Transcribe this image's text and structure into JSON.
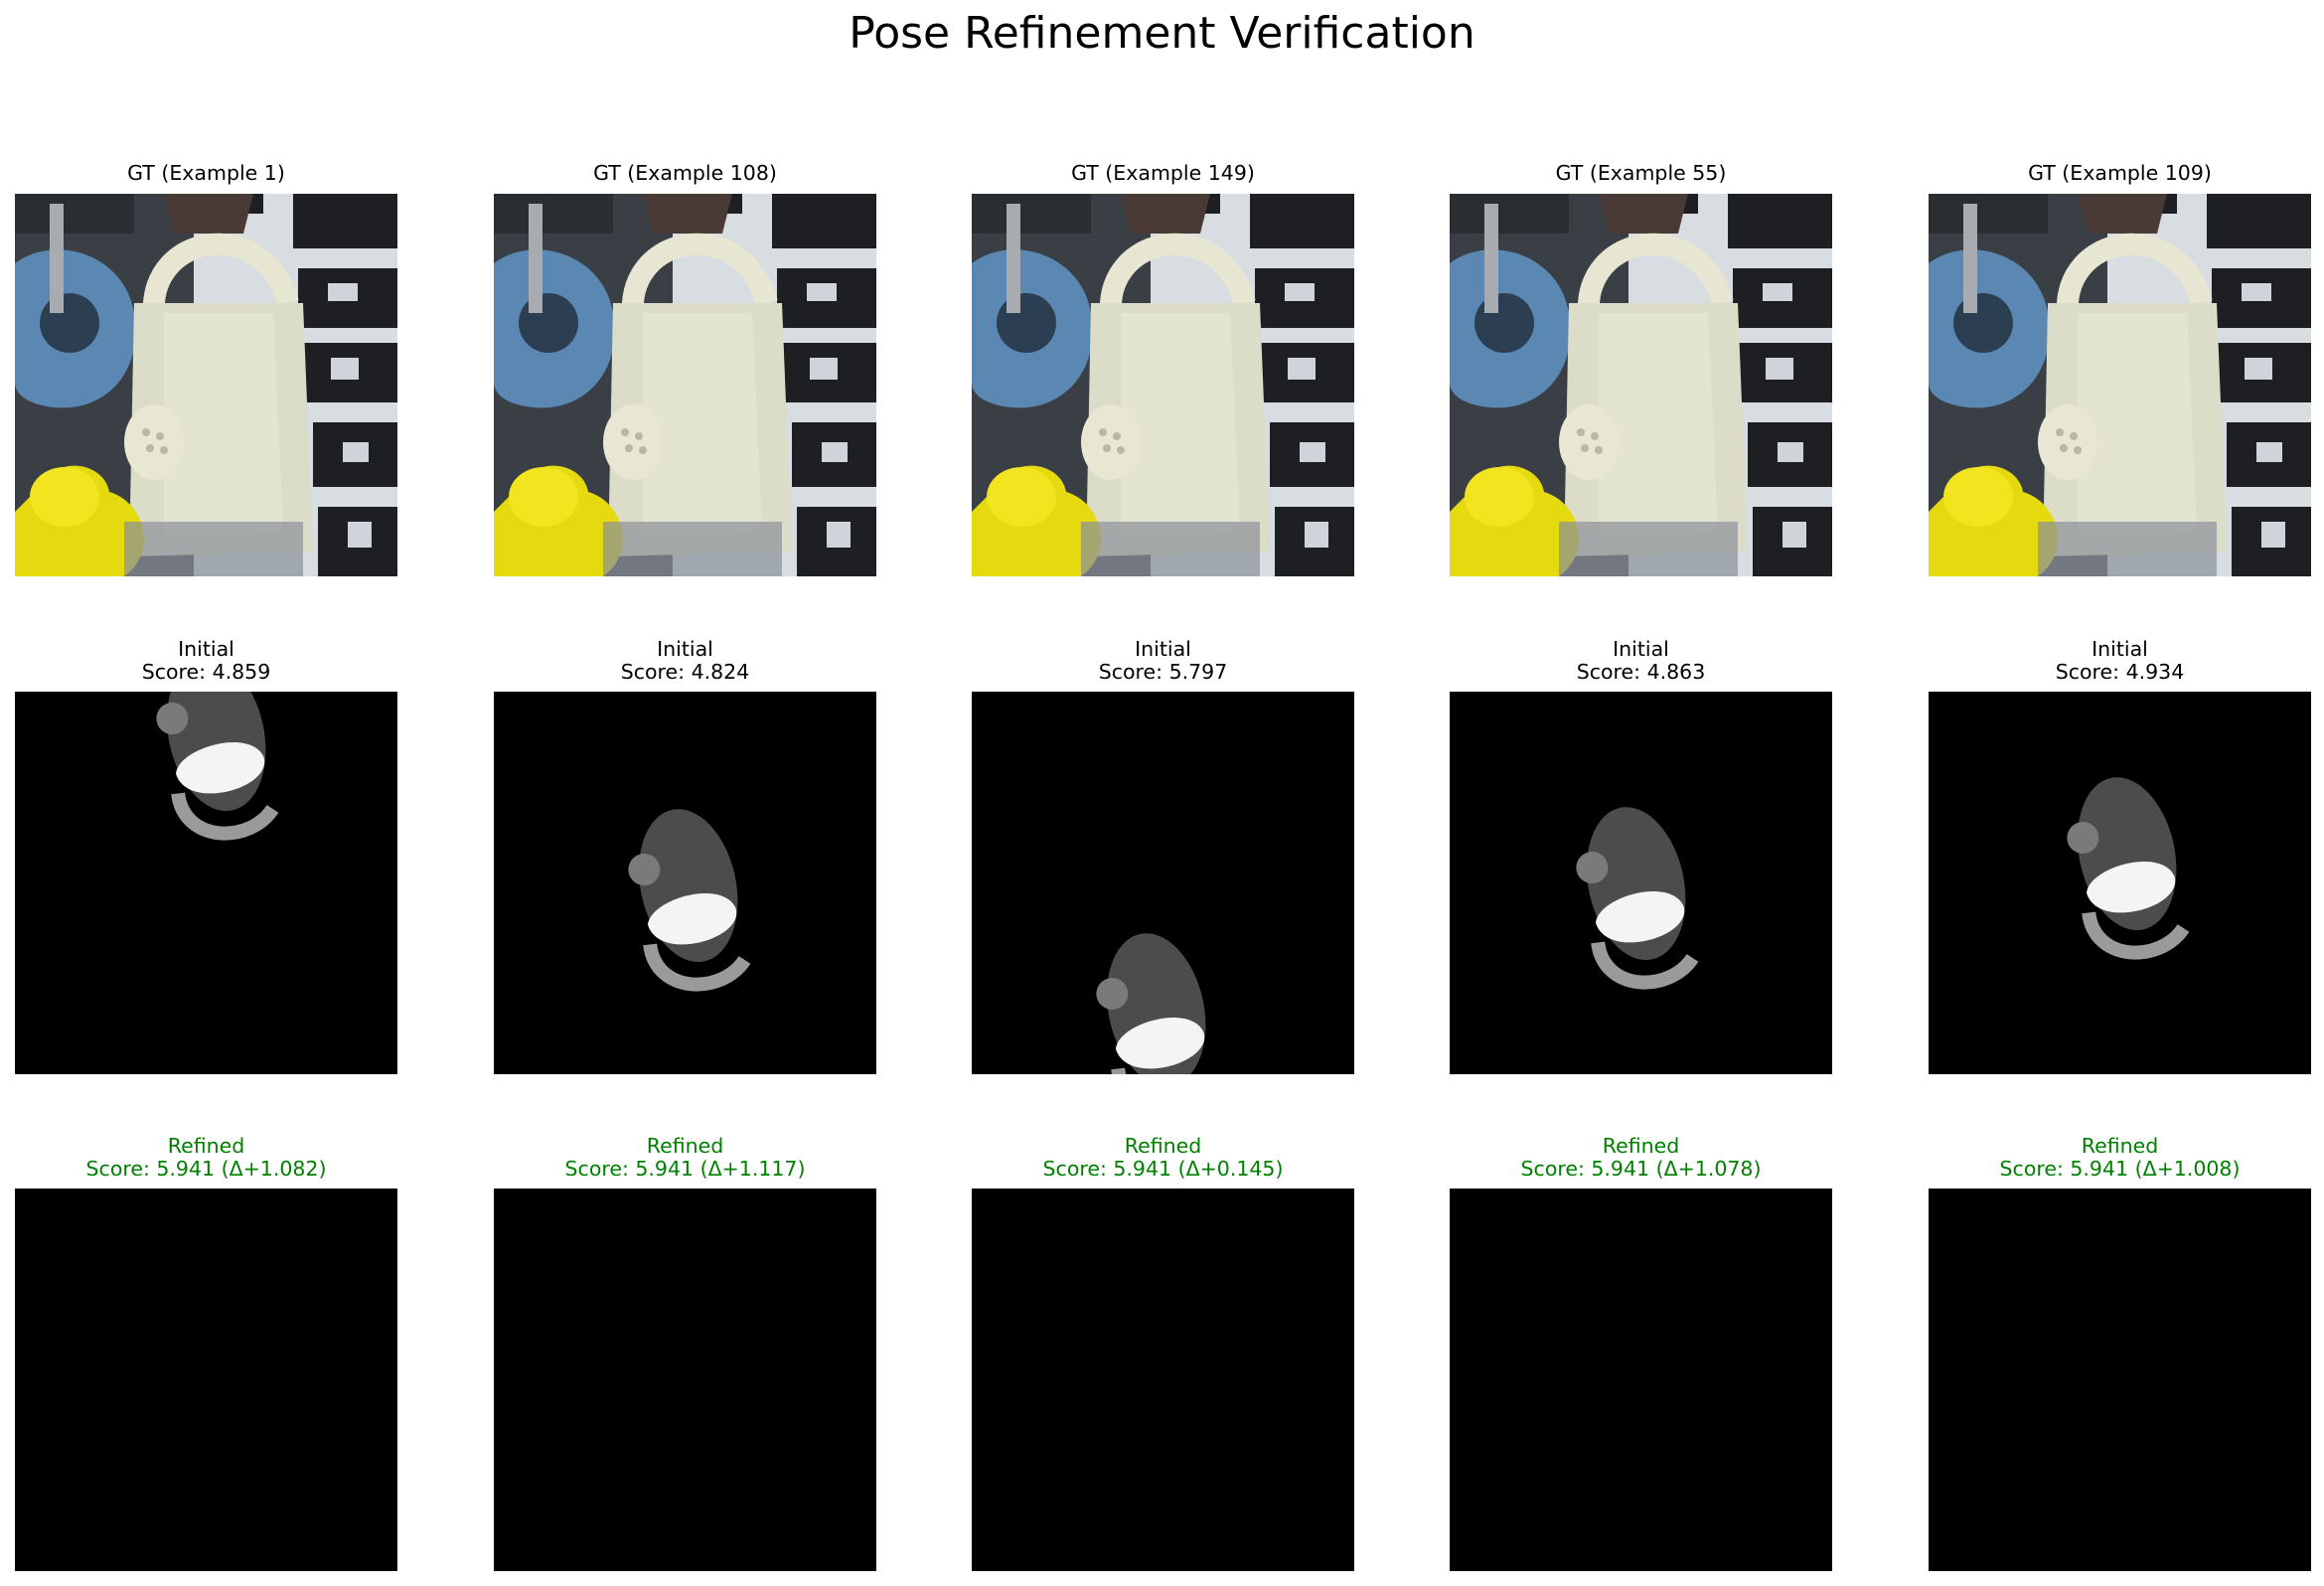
{
  "title": "Pose Refinement Verification",
  "columns": [
    {
      "gt_label": "GT (Example 1)",
      "initial_line1": "Initial",
      "initial_line2": "Score: 4.859",
      "refined_line1": "Refined",
      "refined_line2": "Score: 5.941 (Δ+1.082)"
    },
    {
      "gt_label": "GT (Example 108)",
      "initial_line1": "Initial",
      "initial_line2": "Score: 4.824",
      "refined_line1": "Refined",
      "refined_line2": "Score: 5.941 (Δ+1.117)"
    },
    {
      "gt_label": "GT (Example 149)",
      "initial_line1": "Initial",
      "initial_line2": "Score: 5.797",
      "refined_line1": "Refined",
      "refined_line2": "Score: 5.941 (Δ+0.145)"
    },
    {
      "gt_label": "GT (Example 55)",
      "initial_line1": "Initial",
      "initial_line2": "Score: 4.863",
      "refined_line1": "Refined",
      "refined_line2": "Score: 5.941 (Δ+1.078)"
    },
    {
      "gt_label": "GT (Example 109)",
      "initial_line1": "Initial",
      "initial_line2": "Score: 4.934",
      "refined_line1": "Refined",
      "refined_line2": "Score: 5.941 (Δ+1.008)"
    }
  ],
  "colors": {
    "refined_text": "#008000",
    "render_background": "#000000"
  }
}
